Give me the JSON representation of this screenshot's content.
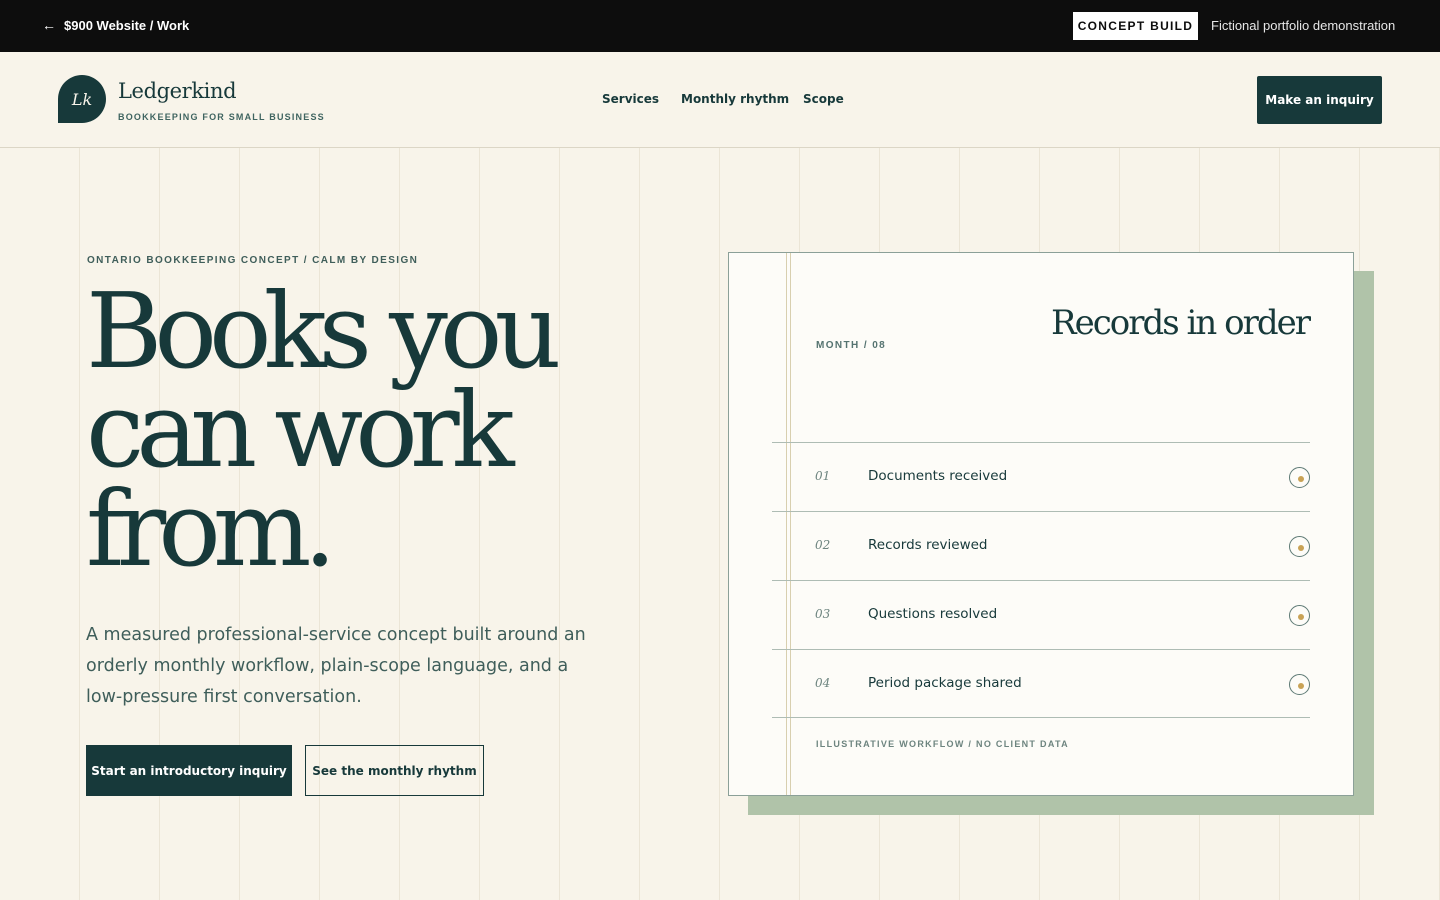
{
  "topbar": {
    "back_label": "$900 Website / Work",
    "badge": "CONCEPT BUILD",
    "note": "Fictional portfolio demonstration"
  },
  "header": {
    "logo_initials": "Lk",
    "brand_name": "Ledgerkind",
    "brand_tagline": "BOOKKEEPING FOR SMALL BUSINESS",
    "nav": [
      {
        "label": "Services"
      },
      {
        "label": "Monthly rhythm"
      },
      {
        "label": "Scope"
      }
    ],
    "cta": "Make an inquiry"
  },
  "hero": {
    "eyebrow": "ONTARIO BOOKKEEPING CONCEPT / CALM BY DESIGN",
    "headline": [
      "Books you",
      "can work",
      "from."
    ],
    "lede": "A measured professional-service concept built around an orderly monthly workflow, plain-scope language, and a low-pressure first conversation.",
    "primary_button": "Start an introductory inquiry",
    "secondary_button": "See the monthly rhythm"
  },
  "card": {
    "month": "MONTH / 08",
    "title": "Records in order",
    "rows": [
      {
        "num": "01",
        "label": "Documents received"
      },
      {
        "num": "02",
        "label": "Records reviewed"
      },
      {
        "num": "03",
        "label": "Questions resolved"
      },
      {
        "num": "04",
        "label": "Period package shared"
      }
    ],
    "footer": "ILLUSTRATIVE WORKFLOW / NO CLIENT DATA"
  },
  "colors": {
    "brand_dark": "#17393a",
    "background": "#f8f4ea",
    "accent_sage": "#b0c3a9",
    "accent_gold": "#c9a255"
  }
}
